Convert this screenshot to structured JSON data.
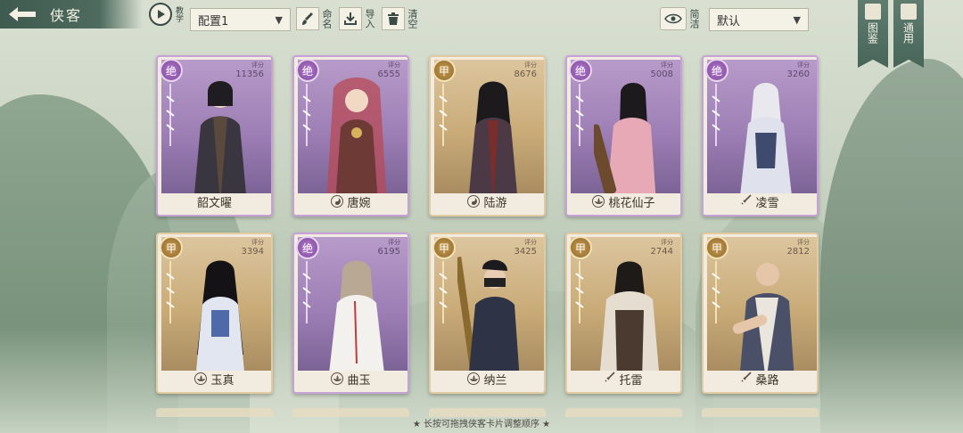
{
  "header": {
    "title": "侠客",
    "tutorial_label": "教学",
    "config_value": "配置1",
    "name_label": "命名",
    "import_label": "导入",
    "clear_label": "清空",
    "simple_label": "简洁",
    "sort_value": "默认",
    "atlas_label": "图鉴",
    "common_label": "通用"
  },
  "score_label": "评分",
  "cards": [
    {
      "name": "韶文曜",
      "rank": "绝",
      "score": "11356",
      "faction_icon": "none"
    },
    {
      "name": "唐婉",
      "rank": "绝",
      "score": "6555",
      "faction_icon": "swirl-icon"
    },
    {
      "name": "陆游",
      "rank": "甲",
      "score": "8676",
      "faction_icon": "swirl-icon"
    },
    {
      "name": "桃花仙子",
      "rank": "绝",
      "score": "5008",
      "faction_icon": "lotus-icon"
    },
    {
      "name": "凌雪",
      "rank": "绝",
      "score": "3260",
      "faction_icon": "sword-icon"
    },
    {
      "name": "玉真",
      "rank": "甲",
      "score": "3394",
      "faction_icon": "lotus-icon"
    },
    {
      "name": "曲玉",
      "rank": "绝",
      "score": "6195",
      "faction_icon": "lotus-icon"
    },
    {
      "name": "纳兰",
      "rank": "甲",
      "score": "3425",
      "faction_icon": "lotus-icon"
    },
    {
      "name": "托雷",
      "rank": "甲",
      "score": "2744",
      "faction_icon": "sword-icon"
    },
    {
      "name": "桑路",
      "rank": "甲",
      "score": "2812",
      "faction_icon": "sword-icon"
    }
  ],
  "hint": "★ 长按可拖拽侠客卡片调整顺序 ★",
  "colors": {
    "jue_accent": "#9d7fb5",
    "jia_accent": "#c9ab78",
    "header_bar": "#4d6b5e"
  }
}
